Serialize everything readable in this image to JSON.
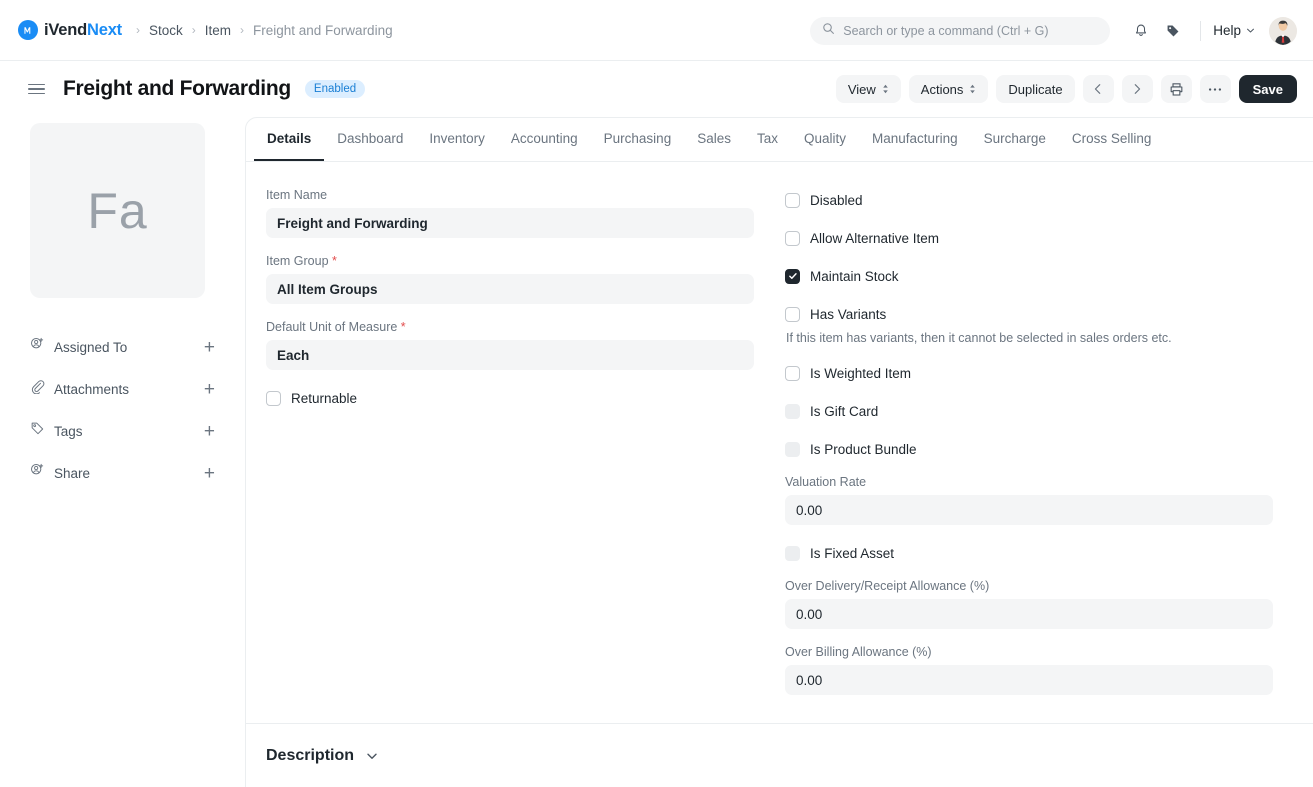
{
  "navbar": {
    "brand": {
      "part1": "iVend",
      "part2": "Next",
      "logo_icon": "ivend-logo-icon"
    },
    "breadcrumbs": [
      {
        "label": "Stock",
        "muted": false
      },
      {
        "label": "Item",
        "muted": false
      },
      {
        "label": "Freight and Forwarding",
        "muted": true
      }
    ],
    "search": {
      "placeholder": "Search or type a command (Ctrl + G)",
      "value": "",
      "icon": "search-icon"
    },
    "notifications_icon": "bell-icon",
    "tags_icon": "tag-icon",
    "help": {
      "label": "Help",
      "icon": "chevron-down-icon"
    },
    "avatar_alt": "user-avatar"
  },
  "titlebar": {
    "menu_icon": "hamburger-icon",
    "title": "Freight and Forwarding",
    "status_badge": "Enabled",
    "buttons": {
      "view": "View",
      "actions": "Actions",
      "duplicate": "Duplicate",
      "prev_icon": "chevron-left-icon",
      "next_icon": "chevron-right-icon",
      "print_icon": "printer-icon",
      "more_icon": "ellipsis-icon",
      "save": "Save"
    }
  },
  "sidebar": {
    "thumbnail_initials": "Fa",
    "items": [
      {
        "label": "Assigned To",
        "icon": "user-add-icon",
        "action": "+"
      },
      {
        "label": "Attachments",
        "icon": "paperclip-icon",
        "action": "+"
      },
      {
        "label": "Tags",
        "icon": "tag-icon",
        "action": "+"
      },
      {
        "label": "Share",
        "icon": "user-add-icon",
        "action": "+"
      }
    ]
  },
  "tabs": [
    {
      "label": "Details",
      "active": true
    },
    {
      "label": "Dashboard",
      "active": false
    },
    {
      "label": "Inventory",
      "active": false
    },
    {
      "label": "Accounting",
      "active": false
    },
    {
      "label": "Purchasing",
      "active": false
    },
    {
      "label": "Sales",
      "active": false
    },
    {
      "label": "Tax",
      "active": false
    },
    {
      "label": "Quality",
      "active": false
    },
    {
      "label": "Manufacturing",
      "active": false
    },
    {
      "label": "Surcharge",
      "active": false
    },
    {
      "label": "Cross Selling",
      "active": false
    }
  ],
  "form": {
    "left": {
      "item_name": {
        "label": "Item Name",
        "value": "Freight and Forwarding",
        "required": false
      },
      "item_group": {
        "label": "Item Group",
        "value": "All Item Groups",
        "required": true,
        "required_mark": "*"
      },
      "default_uom": {
        "label": "Default Unit of Measure",
        "value": "Each",
        "required": true,
        "required_mark": "*"
      },
      "returnable": {
        "label": "Returnable",
        "checked": false,
        "disabled": false
      }
    },
    "right": {
      "disabled_chk": {
        "label": "Disabled",
        "checked": false,
        "disabled": false
      },
      "allow_alternative": {
        "label": "Allow Alternative Item",
        "checked": false,
        "disabled": false
      },
      "maintain_stock": {
        "label": "Maintain Stock",
        "checked": true,
        "disabled": false
      },
      "has_variants": {
        "label": "Has Variants",
        "checked": false,
        "disabled": false
      },
      "has_variants_help": "If this item has variants, then it cannot be selected in sales orders etc.",
      "is_weighted": {
        "label": "Is Weighted Item",
        "checked": false,
        "disabled": false
      },
      "is_gift_card": {
        "label": "Is Gift Card",
        "checked": false,
        "disabled": true
      },
      "is_product_bundle": {
        "label": "Is Product Bundle",
        "checked": false,
        "disabled": true
      },
      "valuation_rate": {
        "label": "Valuation Rate",
        "value": "0.00"
      },
      "is_fixed_asset": {
        "label": "Is Fixed Asset",
        "checked": false,
        "disabled": true
      },
      "over_delivery": {
        "label": "Over Delivery/Receipt Allowance (%)",
        "value": "0.00"
      },
      "over_billing": {
        "label": "Over Billing Allowance (%)",
        "value": "0.00"
      }
    }
  },
  "description_section": {
    "title": "Description",
    "collapse_icon": "chevron-down-icon"
  },
  "colors": {
    "accent": "#1a8cf5",
    "badge_bg": "#dceeff",
    "badge_text": "#1a7fd4",
    "dark": "#1f272e",
    "field_bg": "#f4f5f6",
    "required": "#e24c4c"
  }
}
